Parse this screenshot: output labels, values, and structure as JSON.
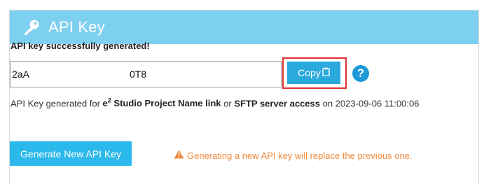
{
  "header": {
    "title": "API Key",
    "icon": "key-icon",
    "color": "#7ed0f0"
  },
  "status": {
    "message": "API key successfully generated!"
  },
  "api_key": {
    "visible_start": "2aA",
    "visible_end": "0T8"
  },
  "buttons": {
    "copy_label": "Copy",
    "copy_icon": "clipboard-icon",
    "generate_label": "Generate New API Key",
    "accent": "#2aa9dd"
  },
  "help": {
    "icon": "question-icon",
    "glyph": "?"
  },
  "info": {
    "prefix": "API Key generated for ",
    "brand": "e",
    "brand_sup": "2",
    "project_link": " Studio Project Name link",
    "or": " or ",
    "sftp": "SFTP server access",
    "on_text": " on 2023-09-06 11:00:06"
  },
  "warning": {
    "icon": "warning-icon",
    "text": "Generating a new API key will replace the previous one.",
    "color": "#f0893a"
  },
  "highlight": {
    "color": "#e03030"
  }
}
